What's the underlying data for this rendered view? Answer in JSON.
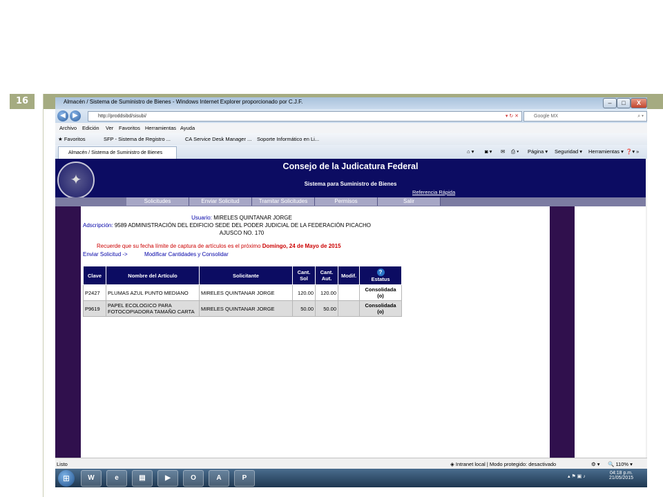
{
  "slide": {
    "number": "16"
  },
  "window": {
    "title": "Almacén / Sistema de Suministro de Bienes - Windows Internet Explorer proporcionado por C.J.F.",
    "url": "http://proddsibd/sisubi/",
    "search_placeholder": "Google MX",
    "controls": [
      "–",
      "□",
      "X"
    ]
  },
  "menubar": [
    "Archivo",
    "Edición",
    "Ver",
    "Favoritos",
    "Herramientas",
    "Ayuda"
  ],
  "favorites": {
    "label": "Favoritos",
    "items": [
      "SFP - Sistema de Registro ...",
      "CA Service Desk Manager ...",
      "Soporte Informático en Li..."
    ]
  },
  "tab": {
    "label": "Almacén / Sistema de Suministro de Bienes"
  },
  "command_bar": [
    "Página ▾",
    "Seguridad ▾",
    "Herramientas ▾"
  ],
  "site": {
    "title": "Consejo de la Judicatura Federal",
    "subtitle": "Sistema para Suministro de Bienes",
    "quick_ref": "Referencia Rápida"
  },
  "nav": [
    "Solicitudes",
    "Enviar Solicitud",
    "Tramitar Solicitudes",
    "Permisos",
    "Salir"
  ],
  "user": {
    "label": "Usuario:",
    "name": "MIRELES QUINTANAR JORGE",
    "adscripcion_label": "Adscripción:",
    "adscripcion": "9589 ADMINISTRACIÓN DEL EDIFICIO SEDE DEL PODER JUDICIAL DE LA FEDERACIÓN PICACHO",
    "adscripcion2": "AJUSCO NO. 170"
  },
  "reminder": {
    "text": "Recuerde que su fecha límite de captura de artículos es el próximo",
    "date": "Domingo, 24 de Mayo de 2015"
  },
  "links": {
    "send": "Enviar Solicitud ->",
    "modify": "Modificar Cantidades y Consolidar"
  },
  "table": {
    "headers": [
      "Clave",
      "Nombre del Artículo",
      "Solicitante",
      "Cant. Sol",
      "Cant. Aut.",
      "Modif.",
      "Estatus"
    ],
    "rows": [
      {
        "clave": "P2427",
        "nombre": "PLUMAS AZUL PUNTO MEDIANO",
        "solicitante": "MIRELES QUINTANAR JORGE",
        "sol": "120.00",
        "aut": "120.00",
        "modif": "",
        "estatus": "Consolidada (o)"
      },
      {
        "clave": "P9619",
        "nombre": "PAPEL ECOLOGICO PARA FOTOCOPIADORA TAMAÑO CARTA",
        "solicitante": "MIRELES QUINTANAR JORGE",
        "sol": "50.00",
        "aut": "50.00",
        "modif": "",
        "estatus": "Consolidada (o)"
      }
    ]
  },
  "statusbar": {
    "left": "Listo",
    "zone": "Intranet local | Modo protegido: desactivado",
    "zoom": "110%"
  },
  "taskbar": {
    "time": "04:18 p.m.",
    "date": "21/05/2015"
  }
}
